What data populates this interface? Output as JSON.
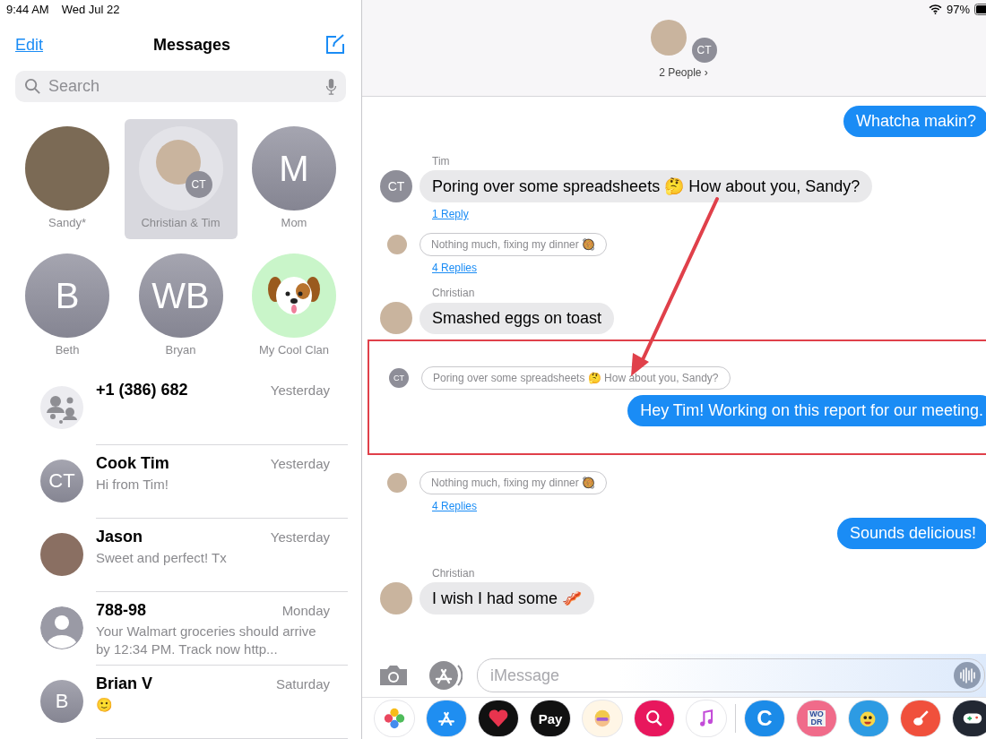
{
  "left_status": {
    "time": "9:44 AM",
    "date": "Wed Jul 22"
  },
  "sidebar": {
    "edit": "Edit",
    "title": "Messages",
    "search": {
      "placeholder": "Search"
    },
    "pinned": [
      {
        "name": "Sandy*",
        "kind": "photo",
        "selected": false
      },
      {
        "name": "Christian & Tim",
        "kind": "group",
        "initials": "CT",
        "selected": true
      },
      {
        "name": "Mom",
        "kind": "initials",
        "initials": "M",
        "selected": false
      },
      {
        "name": "Beth",
        "kind": "initials",
        "initials": "B",
        "selected": false
      },
      {
        "name": "Bryan",
        "kind": "initials",
        "initials": "WB",
        "selected": false
      },
      {
        "name": "My Cool Clan",
        "kind": "animal",
        "selected": false
      }
    ],
    "conversations": [
      {
        "name": "+1 (386) 682",
        "time": "Yesterday",
        "avatar": {
          "kind": "group"
        }
      },
      {
        "name": "Cook Tim",
        "time": "Yesterday",
        "avatar": {
          "kind": "initials",
          "initials": "CT"
        },
        "preview": "Hi from Tim!"
      },
      {
        "name": "Jason",
        "time": "Yesterday",
        "avatar": {
          "kind": "photo"
        },
        "preview": "Sweet and perfect! Tx"
      },
      {
        "name": "788-98",
        "time": "Monday",
        "avatar": {
          "kind": "person"
        },
        "preview": "Your Walmart groceries should arrive by 12:34 PM. Track now http..."
      },
      {
        "name": "Brian V",
        "time": "Saturday",
        "avatar": {
          "kind": "initials",
          "initials": "B"
        },
        "preview": "🙂"
      }
    ]
  },
  "right_status": {
    "battery": "97%"
  },
  "chat_header": {
    "badge_initials": "CT",
    "people": "2 People ›"
  },
  "thread": [
    {
      "kind": "outgoing",
      "text": "Whatcha makin?"
    },
    {
      "kind": "incoming",
      "sender": "Tim",
      "avatar": {
        "kind": "initials",
        "initials": "CT"
      },
      "text": "Poring over some spreadsheets 🤔 How about you, Sandy?",
      "link": "1 Reply"
    },
    {
      "kind": "quote",
      "avatar": {
        "kind": "photo"
      },
      "text": "Nothing much, fixing my dinner 🥘",
      "link": "4 Replies"
    },
    {
      "kind": "incoming",
      "sender": "Christian",
      "avatar": {
        "kind": "photo"
      },
      "text": "Smashed eggs on toast"
    },
    {
      "kind": "highlight",
      "messages": [
        {
          "kind": "quote",
          "avatar": {
            "kind": "initials",
            "initials": "CT"
          },
          "text": "Poring over some spreadsheets 🤔 How about you, Sandy?"
        },
        {
          "kind": "outgoing",
          "text": "Hey Tim! Working on this report for our meeting."
        }
      ]
    },
    {
      "kind": "quote",
      "avatar": {
        "kind": "photo"
      },
      "text": "Nothing much, fixing my dinner 🥘",
      "link": "4 Replies"
    },
    {
      "kind": "outgoing",
      "text": "Sounds delicious!"
    },
    {
      "kind": "incoming",
      "sender": "Christian",
      "avatar": {
        "kind": "photo"
      },
      "text": "I wish I had some 🥓"
    }
  ],
  "composer": {
    "placeholder": "iMessage"
  },
  "app_drawer": [
    {
      "kind": "photos"
    },
    {
      "kind": "store"
    },
    {
      "kind": "heart"
    },
    {
      "kind": "pay",
      "label": "Pay"
    },
    {
      "kind": "memoji"
    },
    {
      "kind": "search"
    },
    {
      "kind": "music"
    },
    {
      "kind": "letter",
      "label": "C"
    },
    {
      "kind": "word",
      "label": "WODR"
    },
    {
      "kind": "cartoon"
    },
    {
      "kind": "guitar"
    },
    {
      "kind": "game"
    }
  ]
}
